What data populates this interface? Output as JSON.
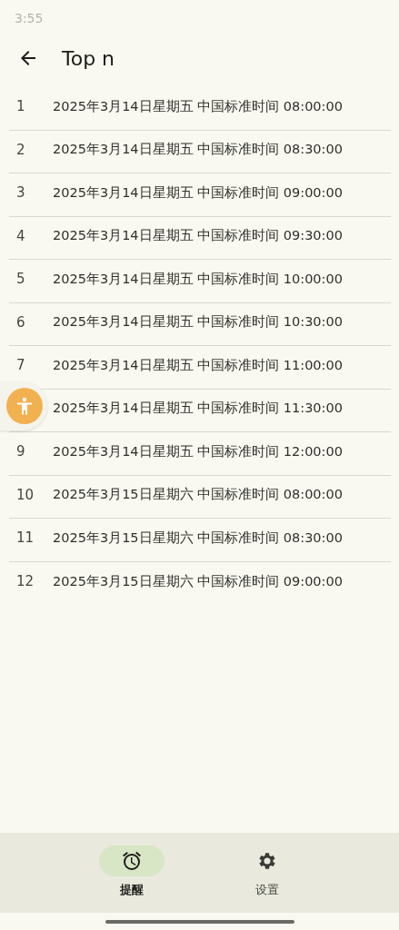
{
  "status_bar": {
    "time": "3:55"
  },
  "header": {
    "title": "Top n"
  },
  "rows": [
    {
      "index": "1",
      "text": "2025年3月14日星期五 中国标准时间 08:00:00"
    },
    {
      "index": "2",
      "text": "2025年3月14日星期五 中国标准时间 08:30:00"
    },
    {
      "index": "3",
      "text": "2025年3月14日星期五 中国标准时间 09:00:00"
    },
    {
      "index": "4",
      "text": "2025年3月14日星期五 中国标准时间 09:30:00"
    },
    {
      "index": "5",
      "text": "2025年3月14日星期五 中国标准时间 10:00:00"
    },
    {
      "index": "6",
      "text": "2025年3月14日星期五 中国标准时间 10:30:00"
    },
    {
      "index": "7",
      "text": "2025年3月14日星期五 中国标准时间 11:00:00"
    },
    {
      "text": "2025年3月14日星期五 中国标准时间 11:30:00"
    },
    {
      "index": "9",
      "text": "2025年3月14日星期五 中国标准时间 12:00:00"
    },
    {
      "index": "10",
      "text": "2025年3月15日星期六 中国标准时间 08:00:00"
    },
    {
      "index": "11",
      "text": "2025年3月15日星期六 中国标准时间 08:30:00"
    },
    {
      "index": "12",
      "text": "2025年3月15日星期六 中国标准时间 09:00:00"
    }
  ],
  "nav": [
    {
      "kind": "alarm",
      "label": "提醒",
      "selected": true
    },
    {
      "kind": "settings",
      "label": "设置",
      "selected": false
    }
  ]
}
